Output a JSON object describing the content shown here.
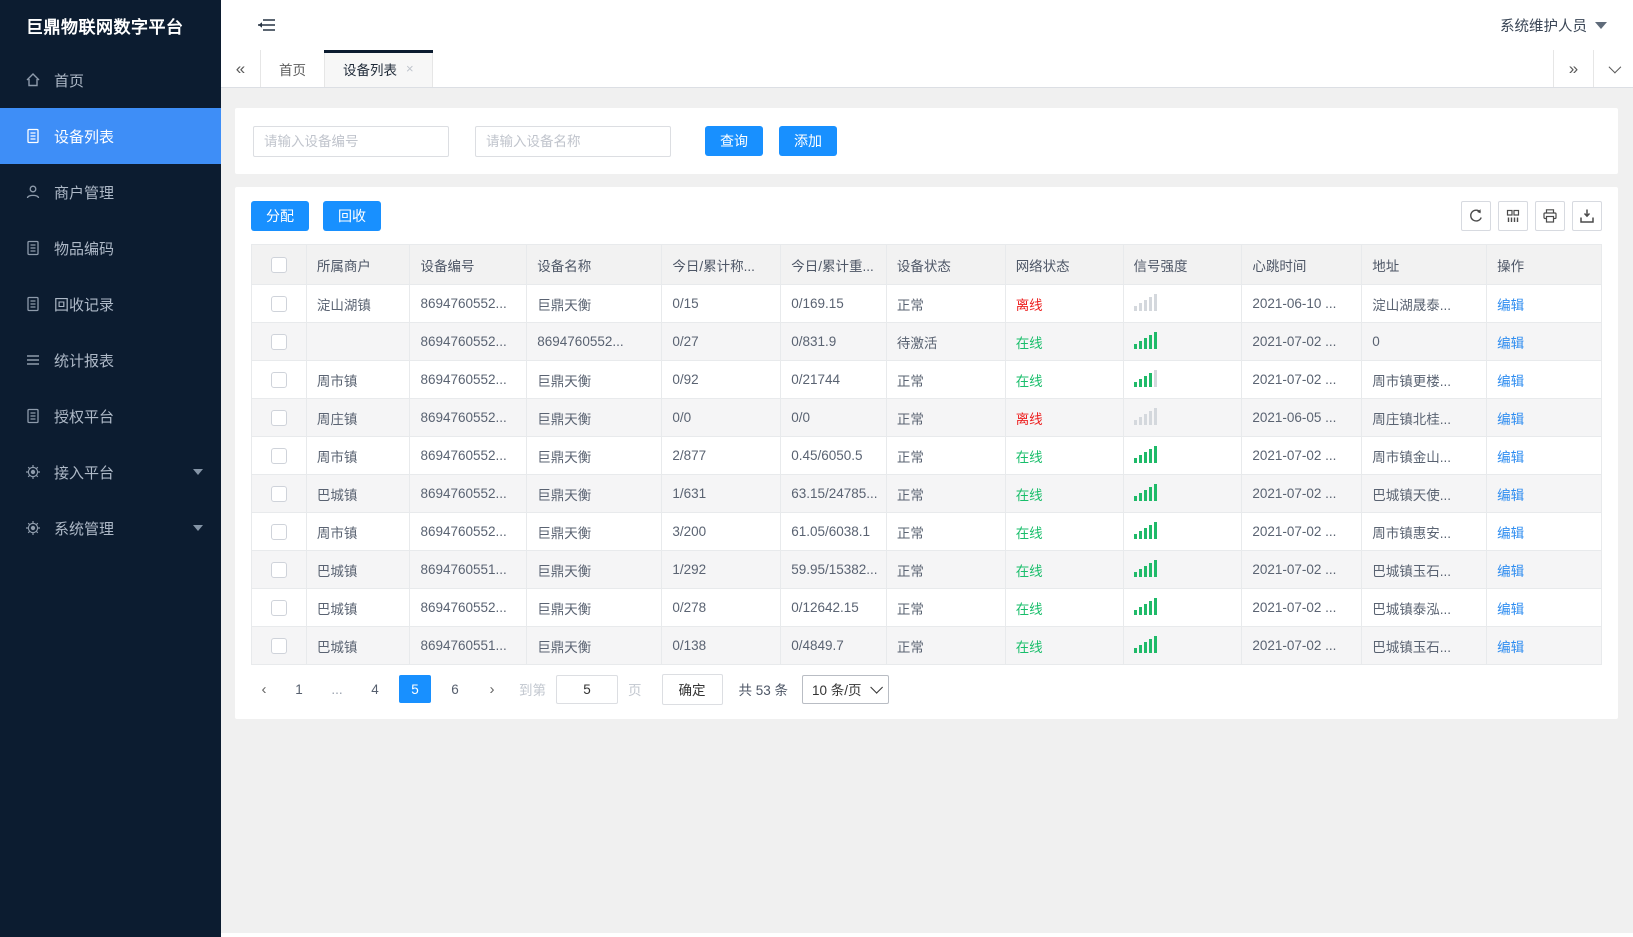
{
  "app": {
    "title": "巨鼎物联网数字平台",
    "user": "系统维护人员"
  },
  "sidebar": {
    "items": [
      {
        "label": "首页",
        "icon": "home-icon",
        "active": false
      },
      {
        "label": "设备列表",
        "icon": "device-list-icon",
        "active": true
      },
      {
        "label": "商户管理",
        "icon": "merchant-icon",
        "active": false
      },
      {
        "label": "物品编码",
        "icon": "item-code-icon",
        "active": false
      },
      {
        "label": "回收记录",
        "icon": "recycle-record-icon",
        "active": false
      },
      {
        "label": "统计报表",
        "icon": "report-icon",
        "active": false
      },
      {
        "label": "授权平台",
        "icon": "authorize-icon",
        "active": false
      },
      {
        "label": "接入平台",
        "icon": "access-platform-icon",
        "active": false,
        "expandable": true
      },
      {
        "label": "系统管理",
        "icon": "system-manage-icon",
        "active": false,
        "expandable": true
      }
    ]
  },
  "tabs": {
    "collapse_left": "«",
    "items": [
      {
        "label": "首页",
        "active": false
      },
      {
        "label": "设备列表",
        "active": true,
        "close": "×"
      }
    ],
    "collapse_right": "»"
  },
  "search": {
    "device_no_placeholder": "请输入设备编号",
    "device_name_placeholder": "请输入设备名称",
    "query_label": "查询",
    "add_label": "添加"
  },
  "toolbar": {
    "assign_label": "分配",
    "recycle_label": "回收",
    "icons": [
      "refresh-icon",
      "columns-icon",
      "print-icon",
      "download-icon"
    ]
  },
  "table": {
    "columns": [
      "所属商户",
      "设备编号",
      "设备名称",
      "今日/累计称...",
      "今日/累计重...",
      "设备状态",
      "网络状态",
      "信号强度",
      "心跳时间",
      "地址",
      "操作"
    ],
    "rows": [
      {
        "merchant": "淀山湖镇",
        "device_no": "8694760552...",
        "device_name": "巨鼎天衡",
        "today_count": "0/15",
        "today_weight": "0/169.15",
        "device_status": "正常",
        "net_status": "离线",
        "net_state": "offline",
        "signal": 0,
        "heartbeat": "2021-06-10 ...",
        "address": "淀山湖晟泰...",
        "action": "编辑"
      },
      {
        "merchant": "",
        "device_no": "8694760552...",
        "device_name": "8694760552...",
        "today_count": "0/27",
        "today_weight": "0/831.9",
        "device_status": "待激活",
        "net_status": "在线",
        "net_state": "online",
        "signal": 5,
        "heartbeat": "2021-07-02 ...",
        "address": "0",
        "action": "编辑"
      },
      {
        "merchant": "周市镇",
        "device_no": "8694760552...",
        "device_name": "巨鼎天衡",
        "today_count": "0/92",
        "today_weight": "0/21744",
        "device_status": "正常",
        "net_status": "在线",
        "net_state": "online",
        "signal": 4,
        "heartbeat": "2021-07-02 ...",
        "address": "周市镇更楼...",
        "action": "编辑"
      },
      {
        "merchant": "周庄镇",
        "device_no": "8694760552...",
        "device_name": "巨鼎天衡",
        "today_count": "0/0",
        "today_weight": "0/0",
        "device_status": "正常",
        "net_status": "离线",
        "net_state": "offline",
        "signal": 0,
        "heartbeat": "2021-06-05 ...",
        "address": "周庄镇北桂...",
        "action": "编辑"
      },
      {
        "merchant": "周市镇",
        "device_no": "8694760552...",
        "device_name": "巨鼎天衡",
        "today_count": "2/877",
        "today_weight": "0.45/6050.5",
        "device_status": "正常",
        "net_status": "在线",
        "net_state": "online",
        "signal": 5,
        "heartbeat": "2021-07-02 ...",
        "address": "周市镇金山...",
        "action": "编辑"
      },
      {
        "merchant": "巴城镇",
        "device_no": "8694760552...",
        "device_name": "巨鼎天衡",
        "today_count": "1/631",
        "today_weight": "63.15/24785...",
        "device_status": "正常",
        "net_status": "在线",
        "net_state": "online",
        "signal": 5,
        "heartbeat": "2021-07-02 ...",
        "address": "巴城镇天使...",
        "action": "编辑"
      },
      {
        "merchant": "周市镇",
        "device_no": "8694760552...",
        "device_name": "巨鼎天衡",
        "today_count": "3/200",
        "today_weight": "61.05/6038.1",
        "device_status": "正常",
        "net_status": "在线",
        "net_state": "online",
        "signal": 5,
        "heartbeat": "2021-07-02 ...",
        "address": "周市镇惠安...",
        "action": "编辑"
      },
      {
        "merchant": "巴城镇",
        "device_no": "8694760551...",
        "device_name": "巨鼎天衡",
        "today_count": "1/292",
        "today_weight": "59.95/15382...",
        "device_status": "正常",
        "net_status": "在线",
        "net_state": "online",
        "signal": 5,
        "heartbeat": "2021-07-02 ...",
        "address": "巴城镇玉石...",
        "action": "编辑"
      },
      {
        "merchant": "巴城镇",
        "device_no": "8694760552...",
        "device_name": "巨鼎天衡",
        "today_count": "0/278",
        "today_weight": "0/12642.15",
        "device_status": "正常",
        "net_status": "在线",
        "net_state": "online",
        "signal": 5,
        "heartbeat": "2021-07-02 ...",
        "address": "巴城镇泰泓...",
        "action": "编辑"
      },
      {
        "merchant": "巴城镇",
        "device_no": "8694760551...",
        "device_name": "巨鼎天衡",
        "today_count": "0/138",
        "today_weight": "0/4849.7",
        "device_status": "正常",
        "net_status": "在线",
        "net_state": "online",
        "signal": 5,
        "heartbeat": "2021-07-02 ...",
        "address": "巴城镇玉石...",
        "action": "编辑"
      }
    ]
  },
  "pagination": {
    "prev": "‹",
    "next": "›",
    "pages": [
      {
        "label": "1"
      },
      {
        "label": "...",
        "ellipsis": true
      },
      {
        "label": "4"
      },
      {
        "label": "5",
        "active": true
      },
      {
        "label": "6"
      }
    ],
    "goto_label": "到第",
    "goto_value": "5",
    "page_label": "页",
    "confirm_label": "确定",
    "total_label": "共 53 条",
    "page_size": "10 条/页"
  },
  "colors": {
    "sidebar_bg": "#0c1c30",
    "sidebar_active": "#3e8ef7",
    "primary_blue": "#1890ff",
    "link_blue": "#2d8cf0",
    "online_green": "#19be6b",
    "offline_red": "#ed1f1f",
    "content_bg": "#f0f0f0"
  }
}
